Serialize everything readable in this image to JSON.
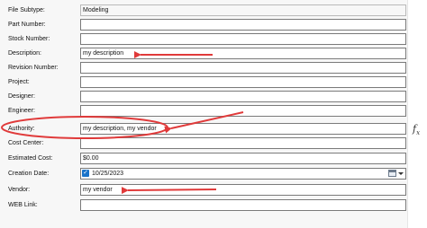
{
  "form": {
    "fields": [
      {
        "label": "File Subtype:",
        "value": "Modeling",
        "readonly": true
      },
      {
        "label": "Part Number:",
        "value": ""
      },
      {
        "label": "Stock Number:",
        "value": ""
      },
      {
        "label": "Description:",
        "value": "my description"
      },
      {
        "label": "Revision Number:",
        "value": ""
      },
      {
        "label": "Project:",
        "value": ""
      },
      {
        "label": "Designer:",
        "value": ""
      },
      {
        "label": "Engineer:",
        "value": ""
      },
      {
        "label": "Authority:",
        "value": "my description, my vendor"
      },
      {
        "label": "Cost Center:",
        "value": ""
      },
      {
        "label": "Estimated Cost:",
        "value": "$0.00"
      },
      {
        "label": "Creation Date:",
        "value": "10/25/2023",
        "type": "date",
        "checked": true
      },
      {
        "label": "Vendor:",
        "value": "my vendor"
      },
      {
        "label": "WEB Link:",
        "value": ""
      }
    ]
  },
  "side_icon": {
    "name": "fx-icon",
    "glyph": "f",
    "sub": "x"
  },
  "annotation_color": "#e03a3a"
}
